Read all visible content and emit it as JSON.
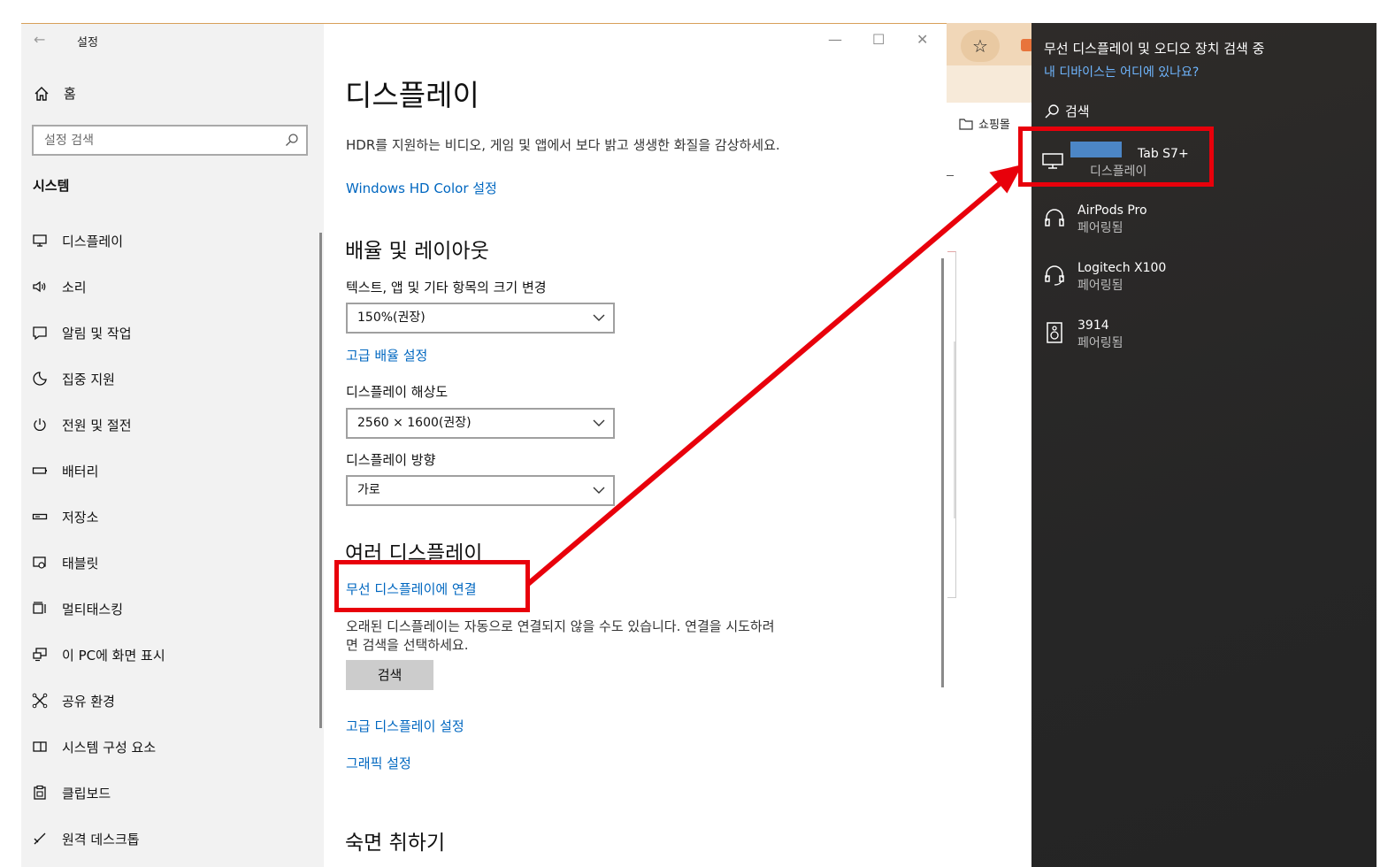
{
  "settings": {
    "window_title": "설정",
    "home_label": "홈",
    "search_placeholder": "설정 검색",
    "section_label": "시스템",
    "nav_items": [
      {
        "label": "디스플레이",
        "icon": "monitor-icon"
      },
      {
        "label": "소리",
        "icon": "speaker-icon"
      },
      {
        "label": "알림 및 작업",
        "icon": "notification-icon"
      },
      {
        "label": "집중 지원",
        "icon": "moon-icon"
      },
      {
        "label": "전원 및 절전",
        "icon": "power-icon"
      },
      {
        "label": "배터리",
        "icon": "battery-icon"
      },
      {
        "label": "저장소",
        "icon": "storage-icon"
      },
      {
        "label": "태블릿",
        "icon": "tablet-icon"
      },
      {
        "label": "멀티태스킹",
        "icon": "multitasking-icon"
      },
      {
        "label": "이 PC에 화면 표시",
        "icon": "project-icon"
      },
      {
        "label": "공유 환경",
        "icon": "shared-experiences-icon"
      },
      {
        "label": "시스템 구성 요소",
        "icon": "components-icon"
      },
      {
        "label": "클립보드",
        "icon": "clipboard-icon"
      },
      {
        "label": "원격 데스크톱",
        "icon": "remote-desktop-icon"
      }
    ],
    "page_title": "디스플레이",
    "hdr_text": "HDR를 지원하는 비디오, 게임 및 앱에서 보다 밝고 생생한 화질을 감상하세요.",
    "hdr_link": "Windows HD Color 설정",
    "scale_heading": "배율 및 레이아웃",
    "scale_label": "텍스트, 앱 및 기타 항목의 크기 변경",
    "scale_value": "150%(권장)",
    "advanced_scale_link": "고급 배율 설정",
    "resolution_label": "디스플레이 해상도",
    "resolution_value": "2560 × 1600(권장)",
    "orientation_label": "디스플레이 방향",
    "orientation_value": "가로",
    "multi_heading": "여러 디스플레이",
    "wireless_link": "무선 디스플레이에 연결",
    "old_display_text": "오래된 디스플레이는 자동으로 연결되지 않을 수도 있습니다. 연결을 시도하려면 검색을 선택하세요.",
    "detect_button": "검색",
    "advanced_display_link": "고급 디스플레이 설정",
    "graphics_link": "그래픽 설정",
    "sleep_heading": "숙면 취하기",
    "win_minimize": "—",
    "win_maximize": "☐",
    "win_close": "✕"
  },
  "browser": {
    "bookmark_label": "쇼핑몰",
    "star": "☆"
  },
  "connect_panel": {
    "title": "무선 디스플레이 및 오디오 장치 검색 중",
    "help_link": "내 디바이스는 어디에 있나요?",
    "search_label": "검색",
    "devices": [
      {
        "name": "Tab S7+",
        "status": "디스플레이",
        "icon": "monitor-icon"
      },
      {
        "name": "AirPods Pro",
        "status": "페어링됨",
        "icon": "headphones-icon"
      },
      {
        "name": "Logitech X100",
        "status": "페어링됨",
        "icon": "headset-icon"
      },
      {
        "name": "3914",
        "status": "페어링됨",
        "icon": "speaker-box-icon"
      }
    ]
  },
  "colors": {
    "link": "#0067c0",
    "annotation_red": "#e8000b",
    "panel_bg": "#2a2a2a",
    "panel_link": "#6fb6ff"
  }
}
